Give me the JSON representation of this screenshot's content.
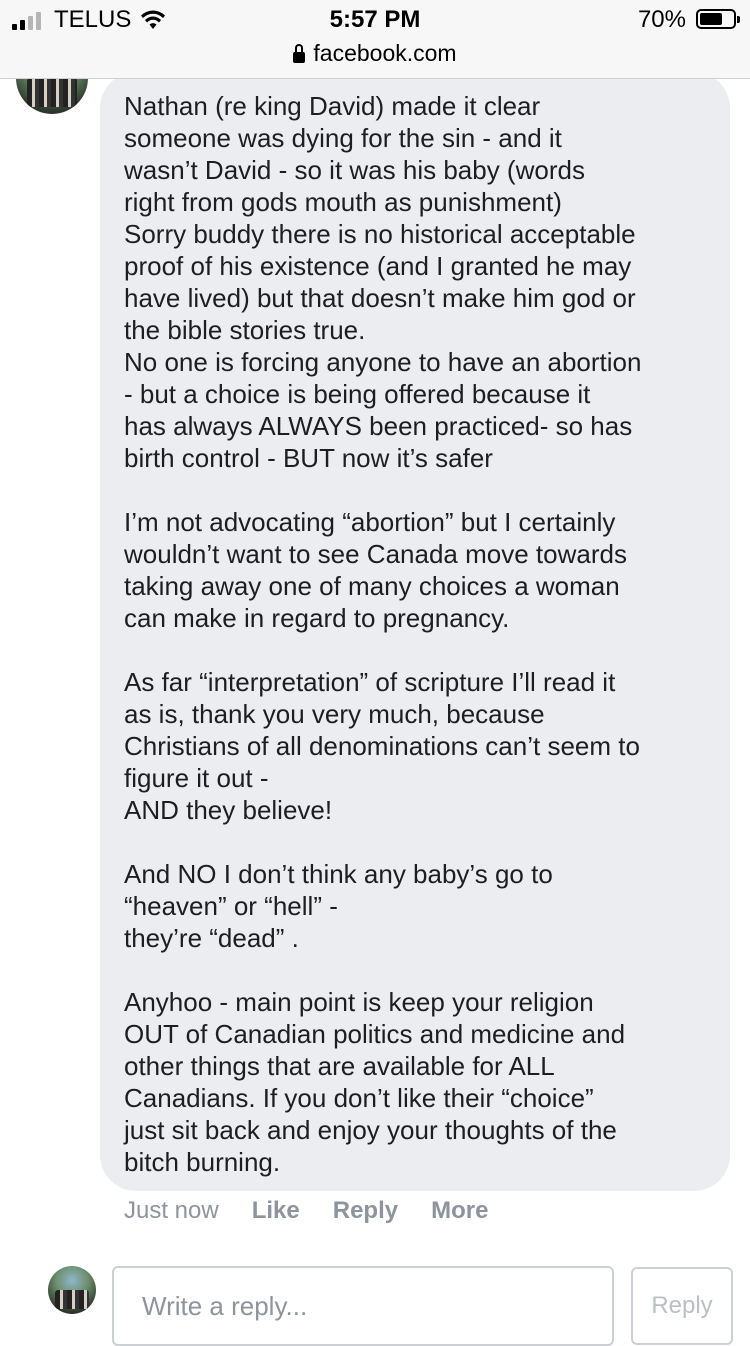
{
  "status_bar": {
    "carrier": "TELUS",
    "time": "5:57 PM",
    "battery_percent": "70%",
    "battery_level": 0.7,
    "signal_bars": 2,
    "url": "facebook.com",
    "icons": [
      "signal-icon",
      "wifi-icon",
      "lock-icon",
      "battery-icon"
    ]
  },
  "comment": {
    "text": "Nathan (re king David) made it clear\nsomeone was dying for the sin - and it\nwasn’t David - so it was his baby (words\nright from gods mouth as punishment)\nSorry buddy there is no historical acceptable\nproof of his existence (and I granted he may\nhave lived) but that doesn’t make him god or\nthe bible stories true.\nNo one is forcing anyone to have an abortion\n- but a choice is being offered because it\nhas always ALWAYS been practiced- so has\nbirth control - BUT now it’s safer\n\nI’m not advocating “abortion” but I certainly\nwouldn’t want to see Canada move towards\ntaking away one of many choices a woman\ncan make in regard to pregnancy.\n\nAs far “interpretation” of scripture I’ll read it\nas is, thank you very much, because\nChristians of all denominations can’t seem to\nfigure it out -\nAND they believe!\n\nAnd NO I don’t think any baby’s go to\n“heaven” or “hell” -\nthey’re “dead” .\n\nAnyhoo - main point is keep your religion\nOUT of Canadian politics and medicine and\nother things that are available for ALL\nCanadians. If you don’t like their “choice”\njust sit back and enjoy your thoughts of the\nbitch burning.",
    "time_ago": "Just now",
    "actions": {
      "like": "Like",
      "reply": "Reply",
      "more": "More"
    }
  },
  "reply_box": {
    "placeholder": "Write a reply...",
    "value": "",
    "button_label": "Reply"
  },
  "colors": {
    "bubble_bg": "#ebedf0",
    "secondary_text": "#8d949e",
    "disabled_button_text": "#bcc0c4"
  }
}
